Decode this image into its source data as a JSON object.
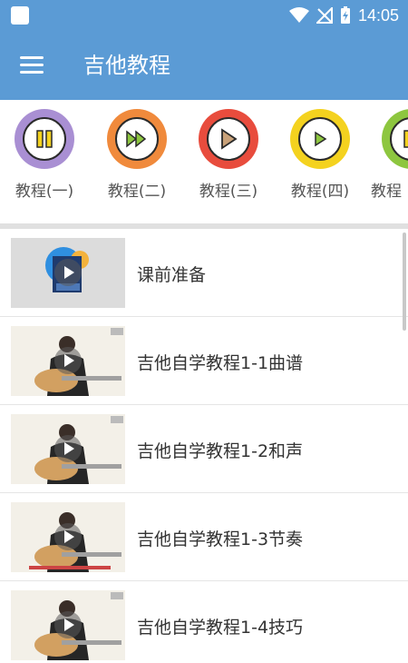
{
  "status_bar": {
    "time": "14:05"
  },
  "app_bar": {
    "title": "吉他教程",
    "menu_icon": "hamburger-menu-icon"
  },
  "categories": [
    {
      "label": "教程(一)",
      "color": "#a98fd3",
      "icon": "pause-icon"
    },
    {
      "label": "教程(二)",
      "color": "#f08a3c",
      "icon": "fast-forward-icon"
    },
    {
      "label": "教程(三)",
      "color": "#e84c3d",
      "icon": "play-icon"
    },
    {
      "label": "教程(四)",
      "color": "#f4d21f",
      "icon": "play-icon"
    },
    {
      "label": "教程",
      "color": "#8dc63f",
      "icon": "pause-icon"
    }
  ],
  "lessons": [
    {
      "title": "课前准备",
      "thumb": "intro"
    },
    {
      "title": "吉他自学教程1-1曲谱",
      "thumb": "guitar"
    },
    {
      "title": "吉他自学教程1-2和声",
      "thumb": "guitar"
    },
    {
      "title": "吉他自学教程1-3节奏",
      "thumb": "guitar"
    },
    {
      "title": "吉他自学教程1-4技巧",
      "thumb": "guitar"
    }
  ],
  "colors": {
    "primary": "#5b9bd5",
    "divider": "#e0e0e0"
  }
}
